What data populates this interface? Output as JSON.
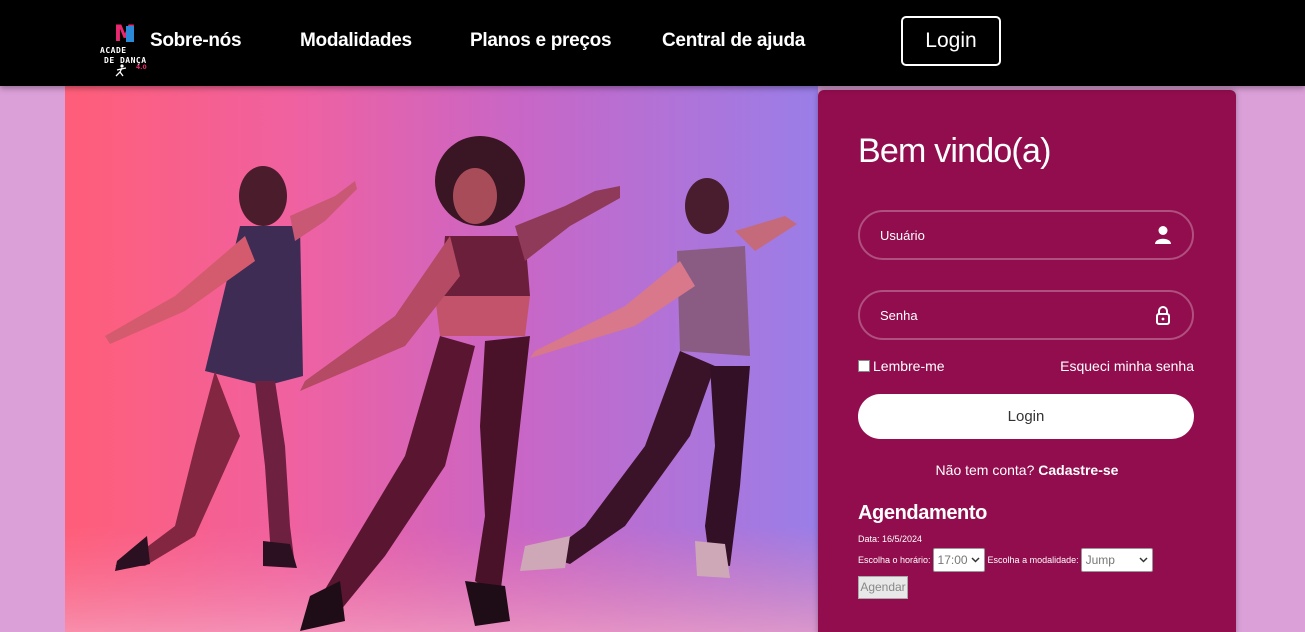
{
  "header": {
    "logo": {
      "line1": "ACADE",
      "line2": "DE DANÇA",
      "accent": "4.0"
    },
    "nav": [
      "Sobre-nós",
      "Modalidades",
      "Planos e preços",
      "Central de ajuda"
    ],
    "login_label": "Login"
  },
  "hero": {
    "image": "three-dancers-illustration",
    "colors": [
      "#ff5e78",
      "#f061a0",
      "#c966c6",
      "#9a7ee8"
    ]
  },
  "panel": {
    "welcome": "Bem vindo(a)",
    "username_placeholder": "Usuário",
    "password_placeholder": "Senha",
    "user_icon": "user-icon",
    "lock_icon": "lock-icon",
    "remember_label": "Lembre-me",
    "forgot_label": "Esqueci minha senha",
    "login_button": "Login",
    "no_account": "Não tem conta?",
    "signup_link": "Cadastre-se",
    "background": "#920d4e"
  },
  "agenda": {
    "title": "Agendamento",
    "date": "Data: 16/5/2024",
    "time_label": "Escolha o horário:",
    "time_value": "17:00",
    "modality_label": "Escolha a modalidade:",
    "modality_value": "Jump",
    "button": "Agendar"
  }
}
